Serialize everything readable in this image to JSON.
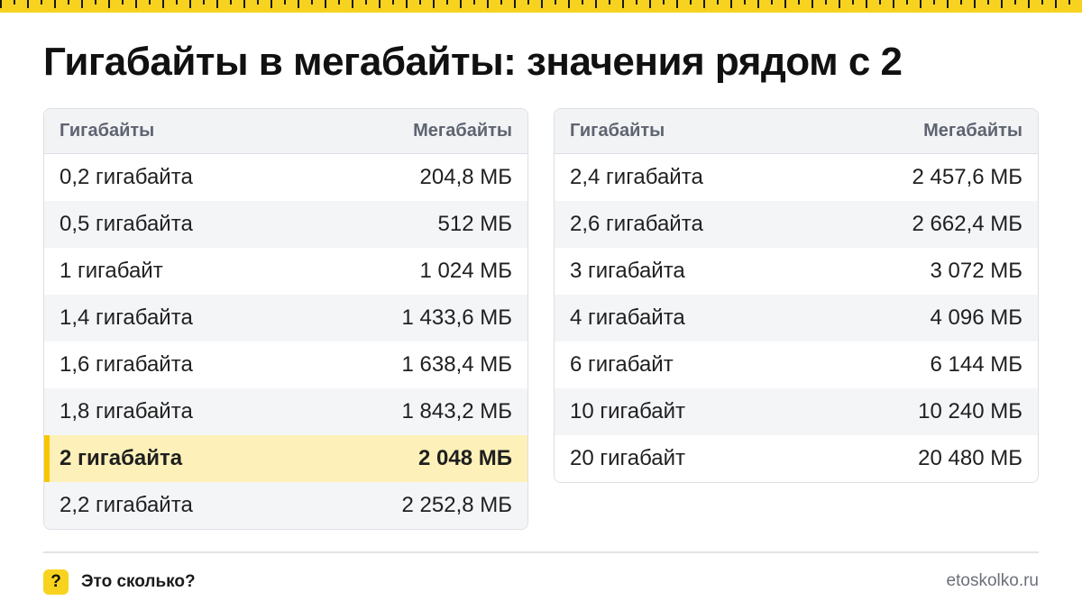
{
  "title": "Гигабайты в мегабайты: значения рядом с 2",
  "colors": {
    "accent_yellow": "#f7d31f",
    "highlight_row": "#fdf1b9",
    "header_bg": "#f2f3f5"
  },
  "tables": [
    {
      "header": {
        "col1": "Гигабайты",
        "col2": "Мегабайты"
      },
      "rows": [
        {
          "gb": "0,2 гигабайта",
          "mb": "204,8 МБ"
        },
        {
          "gb": "0,5 гигабайта",
          "mb": "512 МБ"
        },
        {
          "gb": "1 гигабайт",
          "mb": "1 024 МБ"
        },
        {
          "gb": "1,4 гигабайта",
          "mb": "1 433,6 МБ"
        },
        {
          "gb": "1,6 гигабайта",
          "mb": "1 638,4 МБ"
        },
        {
          "gb": "1,8 гигабайта",
          "mb": "1 843,2 МБ"
        },
        {
          "gb": "2 гигабайта",
          "mb": "2 048 МБ",
          "highlighted": true
        },
        {
          "gb": "2,2 гигабайта",
          "mb": "2 252,8 МБ"
        }
      ]
    },
    {
      "header": {
        "col1": "Гигабайты",
        "col2": "Мегабайты"
      },
      "rows": [
        {
          "gb": "2,4 гигабайта",
          "mb": "2 457,6 МБ"
        },
        {
          "gb": "2,6 гигабайта",
          "mb": "2 662,4 МБ"
        },
        {
          "gb": "3 гигабайта",
          "mb": "3 072 МБ"
        },
        {
          "gb": "4 гигабайта",
          "mb": "4 096 МБ"
        },
        {
          "gb": "6 гигабайт",
          "mb": "6 144 МБ"
        },
        {
          "gb": "10 гигабайт",
          "mb": "10 240 МБ"
        },
        {
          "gb": "20 гигабайт",
          "mb": "20 480 МБ"
        }
      ]
    }
  ],
  "footer": {
    "badge_icon": "question-mark-icon",
    "badge_symbol": "?",
    "brand": "Это сколько?",
    "site": "etoskolko.ru"
  }
}
